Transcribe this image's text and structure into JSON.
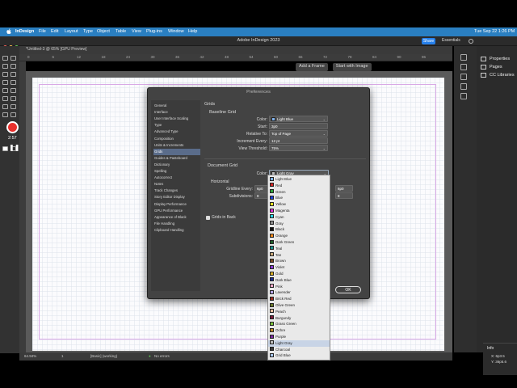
{
  "menubar": {
    "app": "InDesign",
    "items": [
      "File",
      "Edit",
      "Layout",
      "Type",
      "Object",
      "Table",
      "View",
      "Plug-ins",
      "Window",
      "Help"
    ],
    "clock": "Tue Sep 22  1:26 PM"
  },
  "titlebar": {
    "title": "Adobe InDesign 2023",
    "share": "Share",
    "workspace": "Essentials"
  },
  "document": {
    "tab": "*Untitled-3 @ 65% [GPU Preview]"
  },
  "ruler": {
    "numbers": [
      "0",
      "6",
      "12",
      "18",
      "24",
      "30",
      "36",
      "42",
      "48",
      "54",
      "60",
      "66",
      "72",
      "78",
      "84",
      "90",
      "96"
    ]
  },
  "frame_buttons": {
    "add_frame": "Add a Frame",
    "start_image": "Start with Image"
  },
  "recording": {
    "time": "2:57"
  },
  "right_panel": {
    "items": [
      "Properties",
      "Pages",
      "CC Libraries"
    ]
  },
  "info_panel": {
    "title": "Info",
    "x": "X: 6p3.5",
    "y": "Y: 36p5.6"
  },
  "statusbar": {
    "zoom": "64.94%",
    "page": "1",
    "style": "[Basic] (working)",
    "errors": "No errors"
  },
  "preferences": {
    "title": "Preferences",
    "nav": [
      "General",
      "Interface",
      "User Interface Scaling",
      "Type",
      "Advanced Type",
      "Composition",
      "Units & Increments",
      "Grids",
      "Guides & Pasteboard",
      "Dictionary",
      "Spelling",
      "Autocorrect",
      "Notes",
      "Track Changes",
      "Story Editor Display",
      "Display Performance",
      "GPU Performance",
      "Appearance of Black",
      "File Handling",
      "Clipboard Handling"
    ],
    "selected_nav": "Grids",
    "section_title": "Grids",
    "baseline": {
      "title": "Baseline Grid",
      "color_label": "Color:",
      "color_value": "Light Blue",
      "color_hex": "#7fb2ee",
      "start_label": "Start:",
      "start_value": "3p0",
      "relative_label": "Relative To:",
      "relative_value": "Top of Page",
      "increment_label": "Increment Every:",
      "increment_value": "12 pt",
      "threshold_label": "View Threshold:",
      "threshold_value": "75%"
    },
    "document_grid": {
      "title": "Document Grid",
      "color_label": "Color:",
      "color_value": "Light Gray",
      "color_hex": "#bdbdbd",
      "horizontal_title": "Horizontal",
      "gridline_label": "Gridline Every:",
      "gridline_value": "6p0",
      "gridline_value_right": "6p0",
      "subdivisions_label": "Subdivisions:",
      "subdivisions_value": "8",
      "subdivisions_value_right": "8"
    },
    "grids_in_back": "Grids in Back",
    "ok": "OK"
  },
  "color_options": [
    {
      "name": "Light Blue",
      "hex": "#7fb2ee"
    },
    {
      "name": "Red",
      "hex": "#d42525"
    },
    {
      "name": "Green",
      "hex": "#2ea43a"
    },
    {
      "name": "Blue",
      "hex": "#1d43d6"
    },
    {
      "name": "Yellow",
      "hex": "#f2e322"
    },
    {
      "name": "Magenta",
      "hex": "#e02ad6"
    },
    {
      "name": "Cyan",
      "hex": "#2ad3e6"
    },
    {
      "name": "Gray",
      "hex": "#8c8c8c"
    },
    {
      "name": "Black",
      "hex": "#111111"
    },
    {
      "name": "Orange",
      "hex": "#f08a1c"
    },
    {
      "name": "Dark Green",
      "hex": "#1d5f2a"
    },
    {
      "name": "Teal",
      "hex": "#1c8f8a"
    },
    {
      "name": "Tan",
      "hex": "#c8a878"
    },
    {
      "name": "Brown",
      "hex": "#7a4a22"
    },
    {
      "name": "Violet",
      "hex": "#8a3ad6"
    },
    {
      "name": "Gold",
      "hex": "#d6ad22"
    },
    {
      "name": "Dark Blue",
      "hex": "#1a2a8a"
    },
    {
      "name": "Pink",
      "hex": "#f2a8c8"
    },
    {
      "name": "Lavender",
      "hex": "#b8a8ea"
    },
    {
      "name": "Brick Red",
      "hex": "#9a2e22"
    },
    {
      "name": "Olive Green",
      "hex": "#6a7a2a"
    },
    {
      "name": "Peach",
      "hex": "#f4c2a0"
    },
    {
      "name": "Burgundy",
      "hex": "#7a1a3a"
    },
    {
      "name": "Grass Green",
      "hex": "#7ac23a"
    },
    {
      "name": "Ochre",
      "hex": "#c28a2a"
    },
    {
      "name": "Purple",
      "hex": "#7a2aa0"
    },
    {
      "name": "Light Gray",
      "hex": "#bdbdbd"
    },
    {
      "name": "Charcoal",
      "hex": "#3a3a3a"
    },
    {
      "name": "Grid Blue",
      "hex": "#a8c8ee"
    }
  ],
  "color_selected": "Light Gray"
}
